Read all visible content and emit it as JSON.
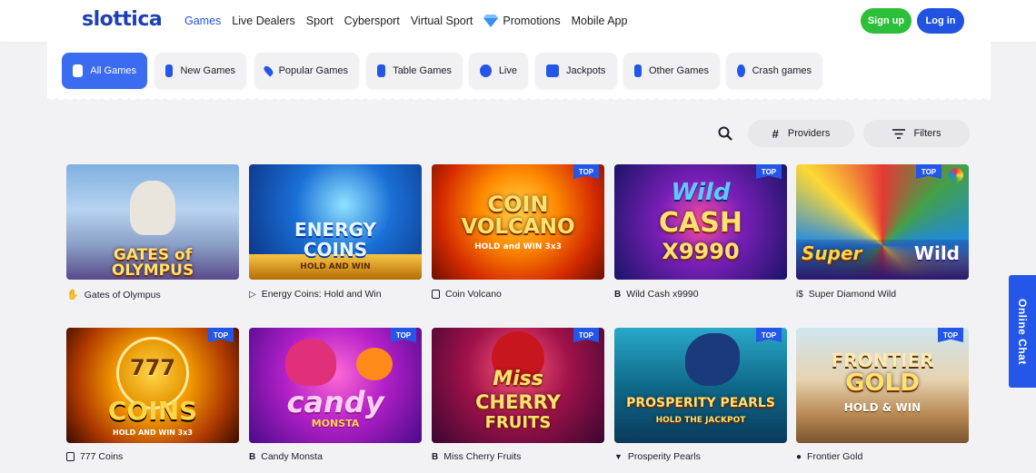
{
  "header": {
    "logo": "slottica",
    "nav": [
      "Games",
      "Live Dealers",
      "Sport",
      "Cybersport",
      "Virtual Sport",
      "Promotions",
      "Mobile App"
    ],
    "signup_label": "Sign up",
    "login_label": "Log in"
  },
  "categories": [
    {
      "label": "All Games",
      "icon": "all-games-icon"
    },
    {
      "label": "New Games",
      "icon": "new-games-icon"
    },
    {
      "label": "Popular Games",
      "icon": "fire-icon"
    },
    {
      "label": "Table Games",
      "icon": "card-icon"
    },
    {
      "label": "Live",
      "icon": "live-icon"
    },
    {
      "label": "Jackpots",
      "icon": "jackpot-icon"
    },
    {
      "label": "Other Games",
      "icon": "other-games-icon"
    },
    {
      "label": "Crash games",
      "icon": "rocket-icon"
    }
  ],
  "toolbar": {
    "providers_label": "Providers",
    "filters_label": "Filters"
  },
  "games": [
    {
      "name": "Gates of Olympus",
      "art": [
        "GATES of OLYMPUS"
      ],
      "top": false
    },
    {
      "name": "Energy Coins: Hold and Win",
      "art": [
        "ENERGY",
        "COINS",
        "HOLD AND WIN"
      ],
      "top": false
    },
    {
      "name": "Coin Volcano",
      "art": [
        "COIN",
        "VOLCANO",
        "HOLD and WIN 3x3"
      ],
      "top": true
    },
    {
      "name": "Wild Cash x9990",
      "art": [
        "Wild",
        "CASH",
        "X9990"
      ],
      "top": true
    },
    {
      "name": "Super Diamond Wild",
      "art": [
        "Super",
        "Wild"
      ],
      "top": true
    },
    {
      "name": "777 Coins",
      "art": [
        "777",
        "COINS",
        "HOLD AND WIN 3x3"
      ],
      "top": true
    },
    {
      "name": "Candy Monsta",
      "art": [
        "candy",
        "MONSTA"
      ],
      "top": true
    },
    {
      "name": "Miss Cherry Fruits",
      "art": [
        "Miss",
        "CHERRY",
        "FRUITS"
      ],
      "top": true
    },
    {
      "name": "Prosperity Pearls",
      "art": [
        "PROSPERITY PEARLS",
        "HOLD THE JACKPOT"
      ],
      "top": true
    },
    {
      "name": "Frontier Gold",
      "art": [
        "FRONTIER",
        "GOLD",
        "HOLD & WIN"
      ],
      "top": true
    }
  ],
  "top_badge": "TOP",
  "chat_label": "Online Chat",
  "colors": {
    "accent": "#2456e8",
    "signup": "#2bbf3a",
    "login": "#2153e0"
  }
}
